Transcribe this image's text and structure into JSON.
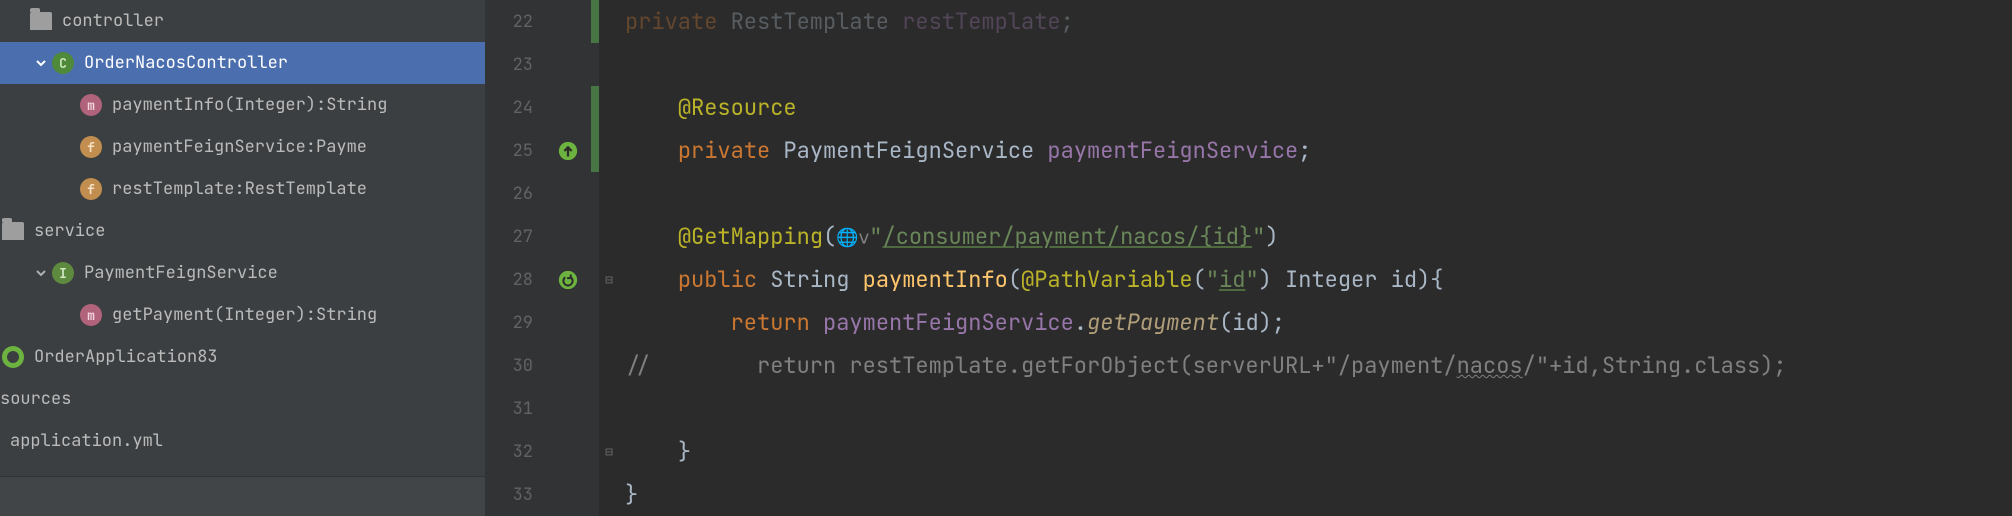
{
  "tree": {
    "controller_folder": "controller",
    "class_name": "OrderNacosController",
    "method1": "paymentInfo(Integer):String",
    "field1": "paymentFeignService:Payme",
    "field2": "restTemplate:RestTemplate",
    "service_folder": "service",
    "interface_name": "PaymentFeignService",
    "iface_method": "getPayment(Integer):String",
    "app_class": "OrderApplication83",
    "sources": "sources",
    "app_yml": "application.yml"
  },
  "lines": [
    {
      "n": "22",
      "vbar": "green"
    },
    {
      "n": "23"
    },
    {
      "n": "24",
      "vbar": "green"
    },
    {
      "n": "25",
      "vbar": "green",
      "icon": "override"
    },
    {
      "n": "26"
    },
    {
      "n": "27"
    },
    {
      "n": "28",
      "icon": "recursive",
      "fold": "⊟"
    },
    {
      "n": "29"
    },
    {
      "n": "30"
    },
    {
      "n": "31"
    },
    {
      "n": "32",
      "fold": "⊟"
    },
    {
      "n": "33"
    }
  ],
  "code": {
    "l22_kw": "private",
    "l22_type": " RestTemplate ",
    "l22_field": "restTemplate",
    "l22_semi": ";",
    "l24_ann": "@Resource",
    "l25_kw": "private",
    "l25_type": " PaymentFeignService ",
    "l25_field": "paymentFeignService",
    "l25_semi": ";",
    "l27_ann": "@GetMapping",
    "l27_p1": "(",
    "l27_globe": "🌐ⅴ",
    "l27_q1": "\"",
    "l27_url": "/consumer/payment/nacos/{id}",
    "l27_q2": "\"",
    "l27_p2": ")",
    "l28_kw": "public",
    "l28_type": " String ",
    "l28_mdef": "paymentInfo",
    "l28_p1": "(",
    "l28_ann": "@PathVariable",
    "l28_p2": "(",
    "l28_q1": "\"",
    "l28_id": "id",
    "l28_q2": "\"",
    "l28_p3": ") Integer id){",
    "l29_kw": "return",
    "l29_sp": " ",
    "l29_field": "paymentFeignService",
    "l29_dot": ".",
    "l29_call": "getPayment",
    "l29_rest": "(id);",
    "l30_cmt": "//        return restTemplate.getForObject(serverURL+\"/payment/",
    "l30_nacos": "nacos",
    "l30_cmt2": "/\"+id,String.class);",
    "l32_brace": "}",
    "l33_brace": "}"
  }
}
